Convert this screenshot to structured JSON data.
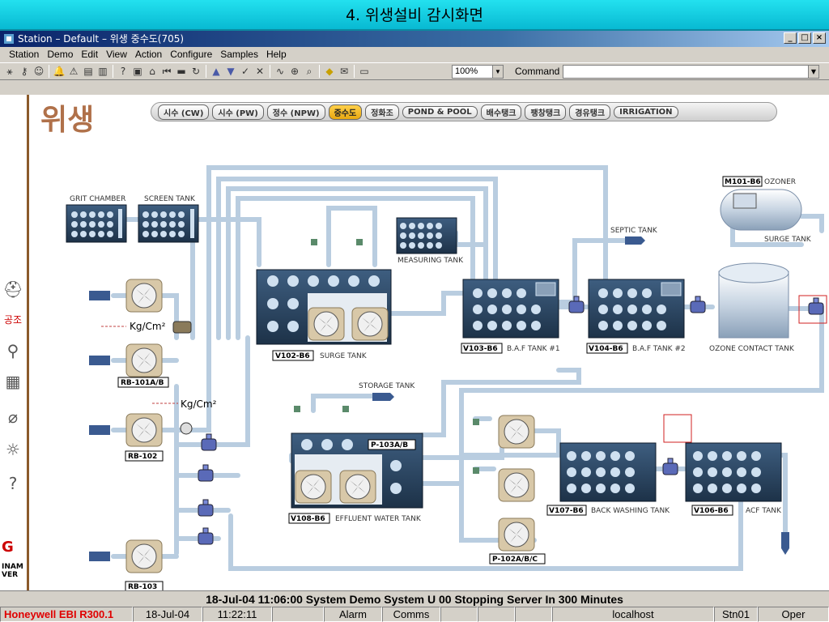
{
  "slide": {
    "title": "4. 위생설비 감시화면"
  },
  "window": {
    "title": "Station – Default – 위생 중수도(705)",
    "min_label": "_",
    "max_label": "□",
    "close_label": "×"
  },
  "menu": [
    "Station",
    "Demo",
    "Edit",
    "View",
    "Action",
    "Configure",
    "Samples",
    "Help"
  ],
  "toolbar": {
    "zoom": "100%",
    "command_label": "Command",
    "command_value": ""
  },
  "display": {
    "heading": "위생",
    "nav": [
      {
        "label": "시수 (CW)",
        "active": false
      },
      {
        "label": "시수 (PW)",
        "active": false
      },
      {
        "label": "정수 (NPW)",
        "active": false
      },
      {
        "label": "중수도",
        "active": true
      },
      {
        "label": "정화조",
        "active": false
      },
      {
        "label": "POND & POOL",
        "active": false
      },
      {
        "label": "배수탱크",
        "active": false
      },
      {
        "label": "팽창탱크",
        "active": false
      },
      {
        "label": "경유탱크",
        "active": false
      },
      {
        "label": "IRRIGATION",
        "active": false
      }
    ],
    "rail": {
      "logo": "G",
      "text1": "INAM",
      "text2": "VER"
    },
    "labels": {
      "grit_chamber": "GRIT CHAMBER",
      "screen_tank": "SCREEN TANK",
      "measuring_tank": "MEASURING TANK",
      "septic_tank": "SEPTIC TANK",
      "ozoner_id": "M101-B6",
      "ozoner": "OZONER",
      "surge_tank_top": "SURGE TANK",
      "v102_id": "V102-B6",
      "v102": "SURGE TANK",
      "v103_id": "V103-B6",
      "v103": "B.A.F TANK #1",
      "v104_id": "V104-B6",
      "v104": "B.A.F TANK #2",
      "ozone_contact": "OZONE CONTACT TANK",
      "kg1": "Kg/Cm²",
      "kg2": "Kg/Cm²",
      "rb101": "RB-101A/B",
      "rb102": "RB-102",
      "rb103": "RB-103",
      "storage_tank": "STORAGE TANK",
      "p103": "P-103A/B",
      "v108_id": "V108-B6",
      "v108": "EFFLUENT WATER TANK",
      "v107_id": "V107-B6",
      "v107": "BACK WASHING TANK",
      "v106_id": "V106-B6",
      "v106": "ACF TANK",
      "p102": "P-102A/B/C"
    }
  },
  "status": {
    "message": "18-Jul-04  11:06:00  System  Demo System    U 00 Stopping Server In 300 Minutes",
    "brand": "Honeywell EBI R300.1",
    "date": "18-Jul-04",
    "time": "11:22:11",
    "alarm": "Alarm",
    "comms": "Comms",
    "host": "localhost",
    "station": "Stn01",
    "role": "Oper"
  },
  "colors": {
    "accent": "#08b9d2",
    "pipe": "#b9cde0",
    "tank": "#2d4660",
    "brand": "#e00000"
  }
}
